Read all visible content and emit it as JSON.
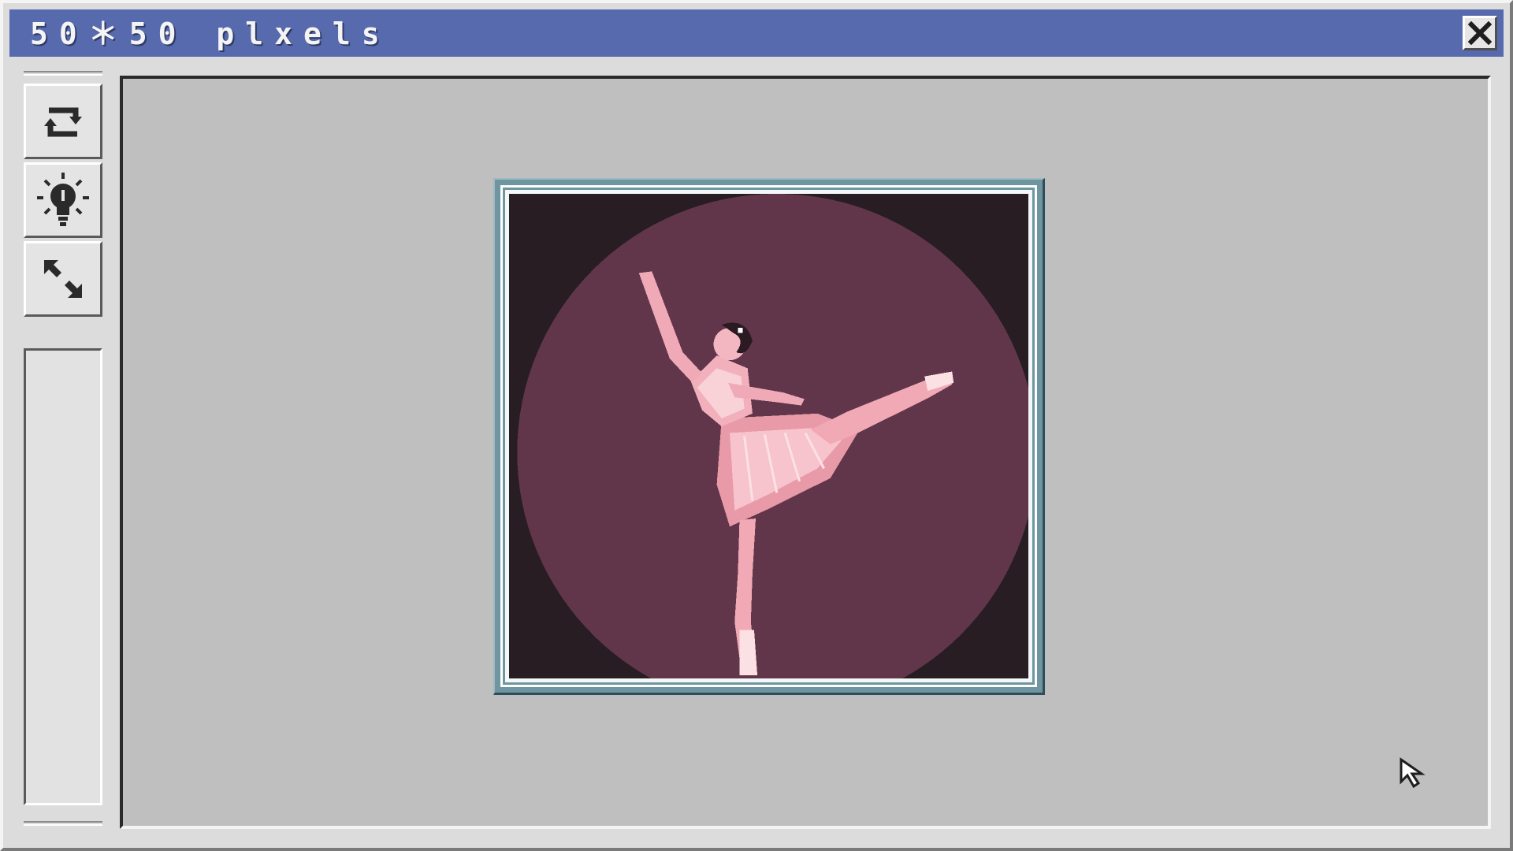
{
  "window": {
    "title": "50＊50 plxels"
  },
  "toolbar": {
    "buttons": [
      {
        "id": "refresh",
        "icon": "refresh-arrows-icon"
      },
      {
        "id": "hint",
        "icon": "lightbulb-hint-icon"
      },
      {
        "id": "shrink",
        "icon": "shrink-arrows-icon"
      }
    ]
  },
  "artwork": {
    "subject": "ballerina",
    "colors": {
      "background": "#281d22",
      "spotlight": "#61364b",
      "frame": "#6e95a0",
      "dancer": "#f2a9b6"
    }
  }
}
